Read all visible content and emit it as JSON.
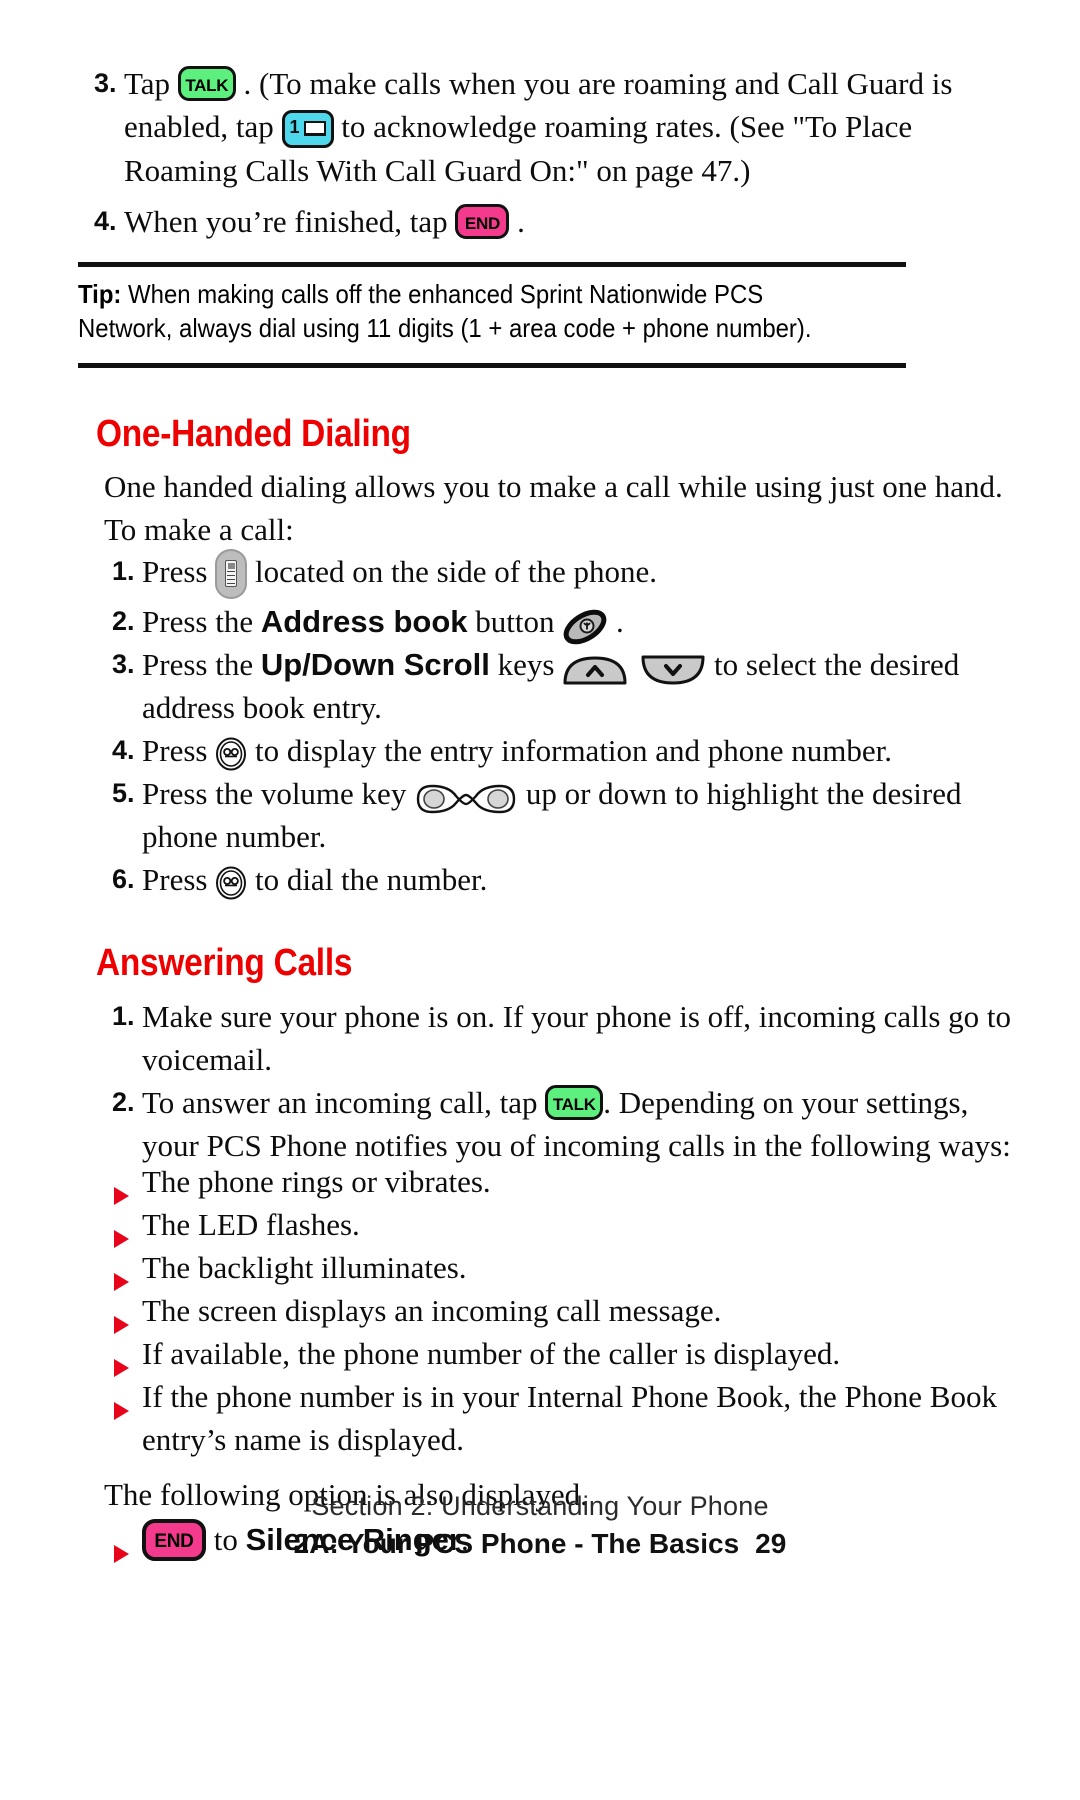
{
  "document": {
    "type": "phone-user-guide-page"
  },
  "colors": {
    "heading_red": "#ee0000",
    "bullet_red": "#e8051c",
    "talk_key_green": "#5df07e",
    "end_key_pink": "#f43a8c",
    "message_key_cyan": "#4fd8ec",
    "side_key_grey": "#bdbdbd",
    "text_black": "#0d0d0d"
  },
  "top_steps": [
    {
      "number": "3.",
      "parts": [
        {
          "kind": "text",
          "value": "Tap "
        },
        {
          "kind": "key",
          "icon": "talk-key",
          "label": "TALK"
        },
        {
          "kind": "text",
          "value": " . (To make calls when you are roaming and Call Guard is enabled, tap "
        },
        {
          "kind": "key",
          "icon": "message-key",
          "label": "1"
        },
        {
          "kind": "text",
          "value": " to acknowledge roaming rates. (See \"To Place Roaming Calls With Call Guard On:\" on page 47.)"
        }
      ]
    },
    {
      "number": "4.",
      "parts": [
        {
          "kind": "text",
          "value": "When you’re finished, tap "
        },
        {
          "kind": "key",
          "icon": "end-key",
          "label": "END"
        },
        {
          "kind": "text",
          "value": " ."
        }
      ]
    }
  ],
  "tip": {
    "label": "Tip:",
    "text": " When making calls off the enhanced Sprint Nationwide PCS Network, always dial using 11 digits (1 + area code + phone number)."
  },
  "section_one": {
    "heading": "One-Handed Dialing",
    "intro": "One handed dialing allows you to make a call while using just one hand. To make a call:",
    "steps": [
      {
        "number": "1.",
        "pre": "Press ",
        "icon": "side-volume-key",
        "post": " located on the side of the phone."
      },
      {
        "number": "2.",
        "pre": "Press the ",
        "bold": "Address book",
        "mid": " button ",
        "icon": "address-book-key",
        "post": " ."
      },
      {
        "number": "3.",
        "pre": "Press the ",
        "bold": "Up/Down Scroll",
        "mid": " keys ",
        "icon": "up-down-scroll-keys",
        "post": " to select the desired address book entry."
      },
      {
        "number": "4.",
        "pre": "Press ",
        "icon": "ok-key",
        "post": " to display the entry information and phone number."
      },
      {
        "number": "5.",
        "pre": "Press the volume key ",
        "icon": "volume-rocker-key",
        "post": " up or down to highlight the desired phone number."
      },
      {
        "number": "6.",
        "pre": "Press ",
        "icon": "ok-key",
        "post": " to dial the number."
      }
    ]
  },
  "section_two": {
    "heading": "Answering Calls",
    "steps": [
      {
        "number": "1.",
        "text": "Make sure your phone is on. If your phone is off, incoming calls go to voicemail."
      },
      {
        "number": "2.",
        "pre": "To answer an incoming call, tap ",
        "icon": "talk-key",
        "icon_label": "TALK",
        "post": ". Depending on your settings, your PCS Phone notifies you of incoming calls in the following ways:"
      }
    ],
    "bullets": [
      "The phone rings or vibrates.",
      "The LED flashes.",
      "The backlight illuminates.",
      "The screen displays an incoming call message.",
      "If available, the phone number of the caller is displayed.",
      "If the phone number is in your Internal Phone Book, the Phone Book entry’s name is displayed."
    ],
    "closing_text": "The following option is also displayed.",
    "final_bullet": {
      "icon": "end-key",
      "icon_label": "END",
      "pre": " to ",
      "bold": "Silence Ringer",
      "post": "."
    }
  },
  "footer": {
    "line1": "Section 2: Understanding Your Phone",
    "line2": "2A: Your PCS Phone - The Basics",
    "page_number": "29"
  }
}
